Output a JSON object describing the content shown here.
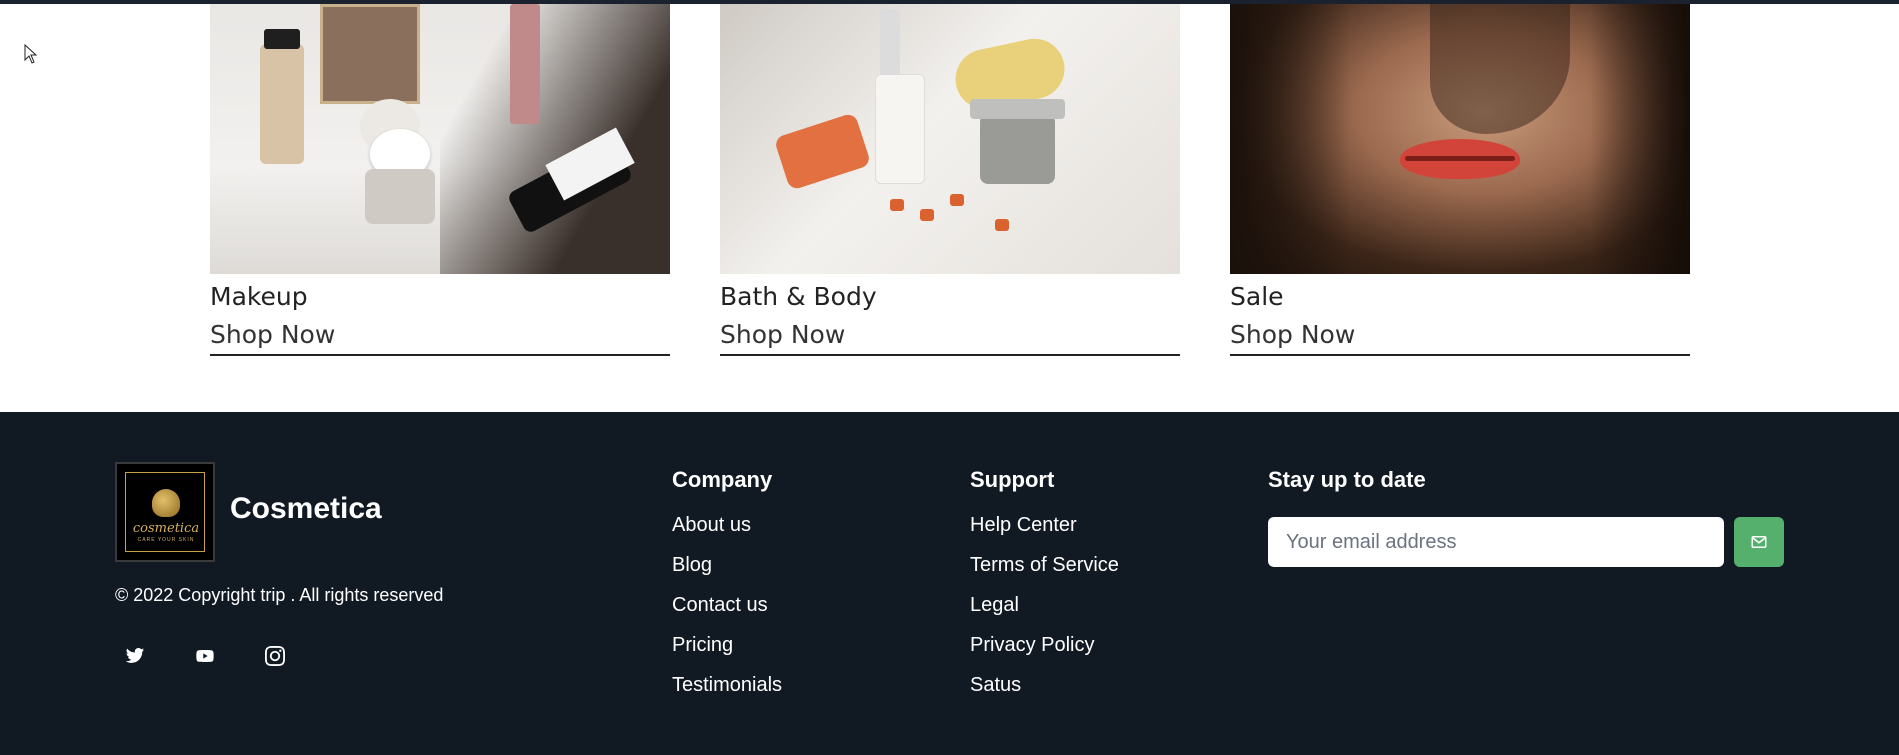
{
  "categories": [
    {
      "title": "Makeup",
      "link": "Shop Now"
    },
    {
      "title": "Bath & Body",
      "link": "Shop Now"
    },
    {
      "title": "Sale",
      "link": "Shop Now"
    }
  ],
  "footer": {
    "brand": "Cosmetica",
    "logo_text": "cosmetica",
    "logo_tagline": "CARE YOUR SKIN",
    "copyright": "© 2022 Copyright trip . All rights reserved",
    "social": [
      "twitter-icon",
      "youtube-icon",
      "instagram-icon"
    ],
    "company": {
      "heading": "Company",
      "links": [
        "About us",
        "Blog",
        "Contact us",
        "Pricing",
        "Testimonials"
      ]
    },
    "support": {
      "heading": "Support",
      "links": [
        "Help Center",
        "Terms of Service",
        "Legal",
        "Privacy Policy",
        "Satus"
      ]
    },
    "newsletter": {
      "heading": "Stay up to date",
      "placeholder": "Your email address",
      "button_icon": "send-icon"
    }
  },
  "colors": {
    "footer_bg": "#111923",
    "accent": "#55b06e"
  }
}
